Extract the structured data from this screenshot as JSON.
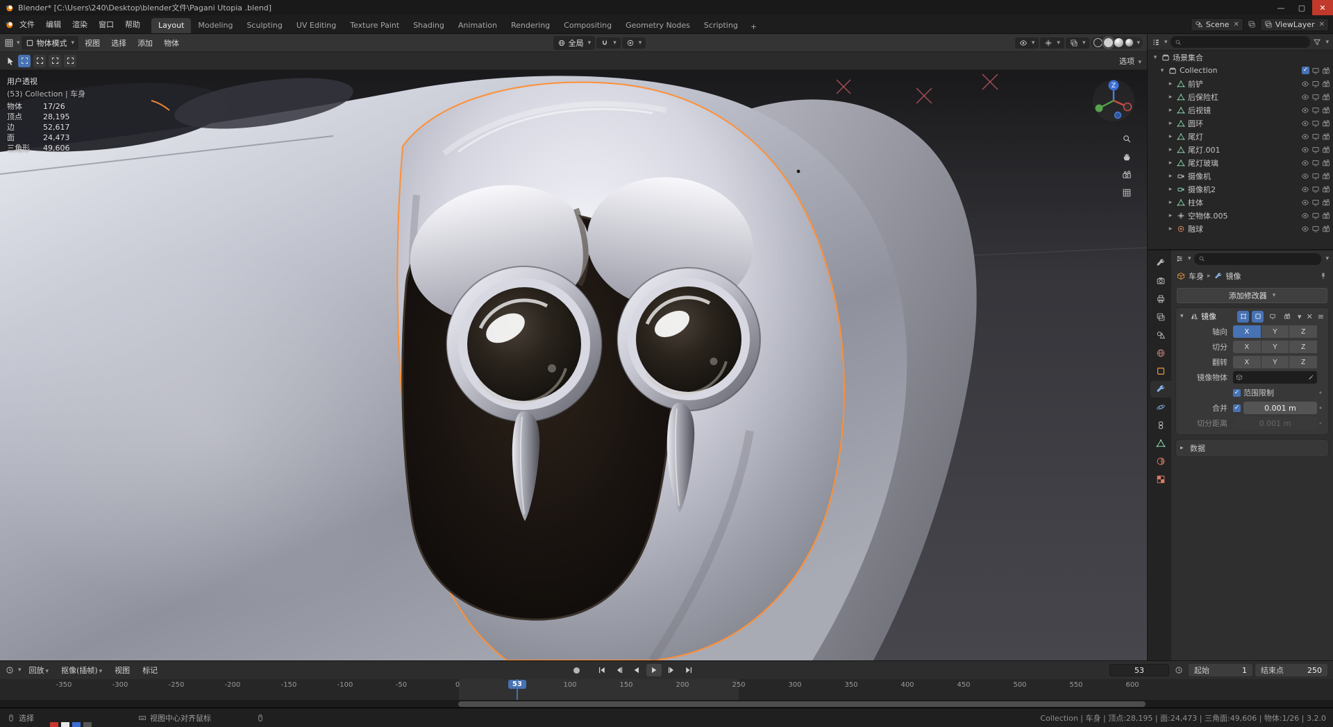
{
  "colors": {
    "accent": "#4772b3",
    "selection_orange": "#ff8f35"
  },
  "title_bar": {
    "title": "Blender* [C:\\Users\\240\\Desktop\\blender文件\\Pagani Utopia .blend]"
  },
  "top_bar": {
    "menus": [
      {
        "label": "文件"
      },
      {
        "label": "编辑"
      },
      {
        "label": "渲染"
      },
      {
        "label": "窗口"
      },
      {
        "label": "帮助"
      }
    ],
    "workspaces": [
      {
        "label": "Layout",
        "active": true
      },
      {
        "label": "Modeling"
      },
      {
        "label": "Sculpting"
      },
      {
        "label": "UV Editing"
      },
      {
        "label": "Texture Paint"
      },
      {
        "label": "Shading"
      },
      {
        "label": "Animation"
      },
      {
        "label": "Rendering"
      },
      {
        "label": "Compositing"
      },
      {
        "label": "Geometry Nodes"
      },
      {
        "label": "Scripting"
      }
    ],
    "add_workspace_label": "+",
    "scene": {
      "label": "Scene"
    },
    "view_layer": {
      "label": "ViewLayer"
    }
  },
  "viewport_header": {
    "mode_label": "物体模式",
    "menus": [
      {
        "label": "视图"
      },
      {
        "label": "选择"
      },
      {
        "label": "添加"
      },
      {
        "label": "物体"
      }
    ],
    "orientation_label": "全局"
  },
  "tool_settings": {
    "options_label": "选项"
  },
  "viewport_overlay": {
    "view_name": "用户透视",
    "context": "(53) Collection | 车身",
    "stats": [
      {
        "label": "物体",
        "value": "17/26"
      },
      {
        "label": "顶点",
        "value": "28,195"
      },
      {
        "label": "边",
        "value": "52,617"
      },
      {
        "label": "面",
        "value": "24,473"
      },
      {
        "label": "三角形",
        "value": "49,606"
      }
    ],
    "gizmo_z_label": "Z"
  },
  "outliner": {
    "search_placeholder": "",
    "scene_collection_label": "场景集合",
    "collection_label": "Collection",
    "items": [
      {
        "label": "前铲",
        "icon": "#sym-mesh",
        "icon_color": "#86d0a5"
      },
      {
        "label": "后保险杠",
        "icon": "#sym-mesh",
        "icon_color": "#86d0a5"
      },
      {
        "label": "后视镜",
        "icon": "#sym-mesh",
        "icon_color": "#86d0a5"
      },
      {
        "label": "圆环",
        "icon": "#sym-mesh",
        "icon_color": "#86d0a5"
      },
      {
        "label": "尾灯",
        "icon": "#sym-mesh",
        "icon_color": "#86d0a5"
      },
      {
        "label": "尾灯.001",
        "icon": "#sym-mesh",
        "icon_color": "#86d0a5"
      },
      {
        "label": "尾灯玻璃",
        "icon": "#sym-mesh",
        "icon_color": "#86d0a5"
      },
      {
        "label": "摄像机",
        "icon": "#sym-camera-obj",
        "icon_color": "#c9c9c9"
      },
      {
        "label": "摄像机2",
        "icon": "#sym-camera-obj",
        "icon_color": "#8fd3b2"
      },
      {
        "label": "柱体",
        "icon": "#sym-mesh",
        "icon_color": "#86d0a5"
      },
      {
        "label": "空物体.005",
        "icon": "#sym-empty",
        "icon_color": "#cfcfcf"
      },
      {
        "label": "融球",
        "icon": "#sym-meta",
        "icon_color": "#e0885f"
      }
    ]
  },
  "properties": {
    "tabs": [
      {
        "icon": "#sym-tool",
        "color": "#b4b4b4"
      },
      {
        "icon": "#sym-render",
        "color": "#b4b4b4"
      },
      {
        "icon": "#sym-printer",
        "color": "#b4b4b4"
      },
      {
        "icon": "#sym-viewlayer",
        "color": "#b4b4b4"
      },
      {
        "icon": "#sym-scene",
        "color": "#b4b4b4"
      },
      {
        "icon": "#sym-world",
        "color": "#c07f7a"
      },
      {
        "icon": "#sym-object",
        "color": "#e8973f"
      },
      {
        "icon": "#sym-tool",
        "color": "#85aede",
        "active": true
      },
      {
        "icon": "#sym-physics",
        "color": "#79a7d6"
      },
      {
        "icon": "#sym-constraint",
        "color": "#b4b4b4"
      },
      {
        "icon": "#sym-mesh",
        "color": "#86d0a5"
      },
      {
        "icon": "#sym-material",
        "color": "#da7a68"
      },
      {
        "icon": "#sym-texture",
        "color": "#da7a68"
      }
    ],
    "breadcrumb": {
      "object_label": "车身",
      "modifier_label": "镜像"
    },
    "add_modifier_label": "添加修改器",
    "modifier": {
      "name": "镜像",
      "axis": {
        "label": "轴向",
        "buttons": [
          {
            "label": "X",
            "active": true
          },
          {
            "label": "Y"
          },
          {
            "label": "Z"
          }
        ]
      },
      "bisect": {
        "label": "切分",
        "buttons": [
          {
            "label": "X"
          },
          {
            "label": "Y"
          },
          {
            "label": "Z"
          }
        ]
      },
      "flip": {
        "label": "翻转",
        "buttons": [
          {
            "label": "X"
          },
          {
            "label": "Y"
          },
          {
            "label": "Z"
          }
        ]
      },
      "mirror_object_label": "镜像物体",
      "clipping_label": "范围限制",
      "merge_label": "合并",
      "merge_value": "0.001 m",
      "bisect_distance_label": "切分距离",
      "bisect_distance_value": "0.001 m",
      "data_label": "数据"
    }
  },
  "timeline": {
    "playback_label": "回放",
    "keying_label": "抠像(插帧)",
    "view_label": "视图",
    "marker_label": "标记",
    "current_frame": "53",
    "start_label": "起始",
    "start_value": "1",
    "end_label": "结束点",
    "end_value": "250",
    "ticks": [
      -350,
      -300,
      -250,
      -200,
      -150,
      -100,
      -50,
      0,
      100,
      150,
      200,
      250,
      300,
      350,
      400,
      450,
      500,
      550,
      600
    ]
  },
  "status_bar": {
    "left_label": "选择",
    "center_label": "视图中心对齐鼠标",
    "info": "Collection | 车身 | 顶点:28,195 | 面:24,473 | 三角面:49,606 | 物体:1/26 | 3.2.0"
  }
}
